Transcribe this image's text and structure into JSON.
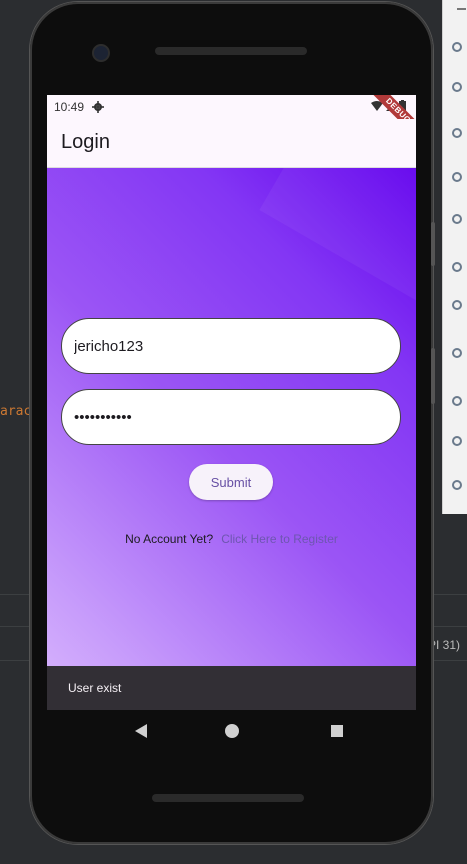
{
  "ide": {
    "left_snippet": "arac",
    "right_snippet": "PI 31)"
  },
  "status_bar": {
    "time": "10:49",
    "debug_banner": "DEBUG"
  },
  "app_bar": {
    "title": "Login"
  },
  "form": {
    "username_value": "jericho123",
    "password_value": "•••••••••••",
    "submit_label": "Submit"
  },
  "register": {
    "question": "No Account Yet?",
    "link_label": "Click Here to Register"
  },
  "snackbar": {
    "message": "User exist"
  },
  "colors": {
    "gradient_start": "#6200ee",
    "gradient_end": "#d3aefc",
    "appbar_bg": "#fdf7fe",
    "button_text": "#6750a4",
    "link": "#6e56b0",
    "snackbar_bg": "#322f35"
  },
  "icons": [
    "gear-icon",
    "wifi-icon",
    "signal-icon",
    "battery-icon",
    "back-icon",
    "home-icon",
    "recents-icon"
  ]
}
